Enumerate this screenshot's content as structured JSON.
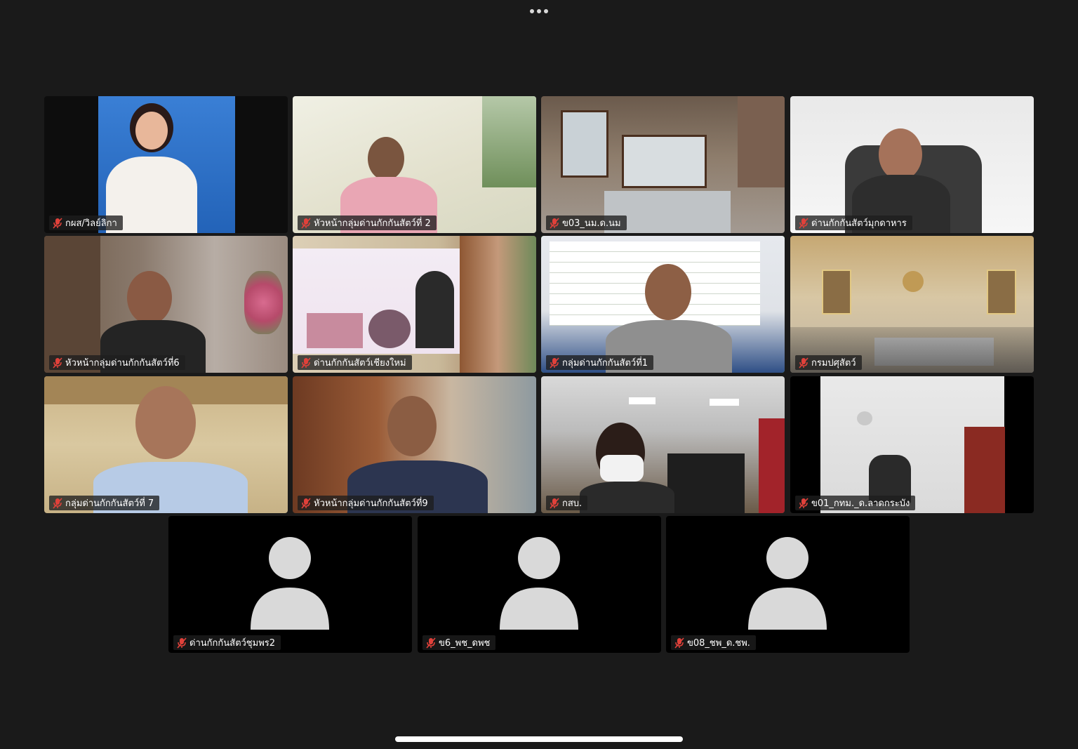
{
  "meeting": {
    "more_options_icon": "ellipsis-icon",
    "active_speaker": "กลุ่มด่านกักกันสัตว์ที่1",
    "accent_color": "#5fd35a",
    "muted_icon_color": "#e0413a"
  },
  "participants": [
    {
      "name": "กผส/วิลย์ลิกา",
      "muted": true,
      "video": true
    },
    {
      "name": "หัวหน้ากลุ่มด่านกักกันสัตว์ที่ 2",
      "muted": true,
      "video": true
    },
    {
      "name": "ข03_นม.ด.นม",
      "muted": true,
      "video": true
    },
    {
      "name": "ด่านกักกันสัตว์มุกดาหาร",
      "muted": true,
      "video": true
    },
    {
      "name": "หัวหน้ากลุ่มด่านกักกันสัตว์ที่6",
      "muted": true,
      "video": true
    },
    {
      "name": "ด่านกักกันสัตว์เชียงใหม่",
      "muted": true,
      "video": true
    },
    {
      "name": "กลุ่มด่านกักกันสัตว์ที่1",
      "muted": true,
      "video": true
    },
    {
      "name": "กรมปศุสัตว์",
      "muted": true,
      "video": true
    },
    {
      "name": "กลุ่มด่านกักกันสัตว์ที่ 7",
      "muted": true,
      "video": true
    },
    {
      "name": "หัวหน้ากลุ่มด่านกักกันสัตว์ที่9",
      "muted": true,
      "video": true
    },
    {
      "name": "กสบ.",
      "muted": true,
      "video": true
    },
    {
      "name": "ข01_กทม._ด.ลาดกระบัง",
      "muted": true,
      "video": true
    },
    {
      "name": "ด่านกักกันสัตว์ชุมพร2",
      "muted": true,
      "video": false
    },
    {
      "name": "ข6_พช_ดพช",
      "muted": true,
      "video": false
    },
    {
      "name": "ข08_ชพ_ด.ชพ.",
      "muted": true,
      "video": false
    }
  ]
}
